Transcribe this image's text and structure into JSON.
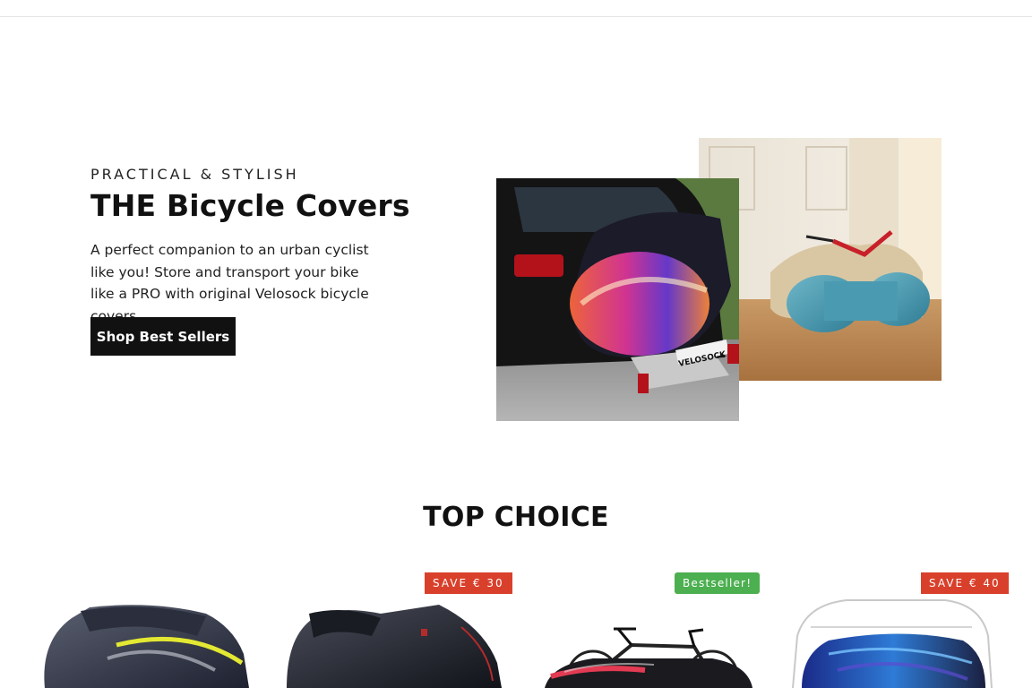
{
  "hero": {
    "eyebrow": "PRACTICAL & STYLISH",
    "title": "THE Bicycle Covers",
    "description": "A perfect companion to an urban cyclist like you! Store and transport your bike like a PRO with original Velosock bicycle covers",
    "cta_label": "Shop Best Sellers",
    "photo_brand_text": "VELOSOCK"
  },
  "section": {
    "title": "TOP CHOICE"
  },
  "products": [
    {
      "badge": "",
      "badge_type": "none"
    },
    {
      "badge": "SAVE € 30",
      "badge_type": "save"
    },
    {
      "badge": "Bestseller!",
      "badge_type": "best"
    },
    {
      "badge": "SAVE € 40",
      "badge_type": "save"
    }
  ],
  "colors": {
    "save_badge": "#d9402b",
    "bestseller_badge": "#4caf50",
    "cta_background": "#111111"
  }
}
